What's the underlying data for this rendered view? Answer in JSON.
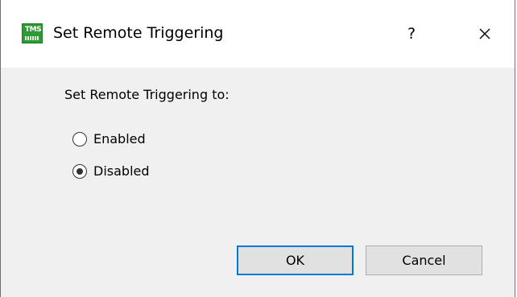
{
  "window": {
    "title": "Set Remote Triggering",
    "icon": "tms-app-icon",
    "icon_text": "TMS",
    "help_label": "?",
    "close_icon": "close-icon"
  },
  "form": {
    "prompt": "Set Remote Triggering to:",
    "options": [
      {
        "label": "Enabled",
        "selected": false
      },
      {
        "label": "Disabled",
        "selected": true
      }
    ]
  },
  "buttons": {
    "ok_label": "OK",
    "cancel_label": "Cancel"
  },
  "colors": {
    "accent": "#0078d7",
    "icon_green": "#2f9a34",
    "dialog_background": "#f0f0f0"
  }
}
